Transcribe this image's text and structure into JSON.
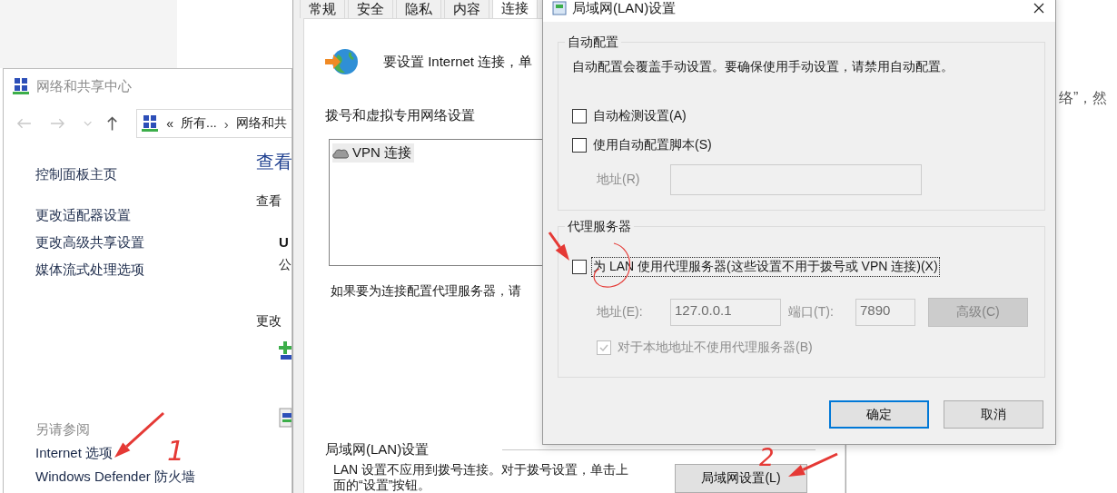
{
  "background_page": {
    "text": "络”，然"
  },
  "network_center": {
    "title": "网络和共享中心",
    "address": {
      "overflow": "«",
      "segments": [
        "所有...",
        "网络和共"
      ],
      "separator": "›"
    },
    "sidebar": {
      "items": [
        "控制面板主页",
        "更改适配器设置",
        "更改高级共享设置",
        "媒体流式处理选项"
      ],
      "see_also": {
        "title": "另请参阅",
        "items": [
          "Internet 选项",
          "Windows Defender 防火墙"
        ]
      }
    },
    "main": {
      "heading": "查看",
      "subheading": "查看",
      "network_name": "U",
      "network_type": "公",
      "change_heading": "更改"
    }
  },
  "internet_options": {
    "tabs": [
      {
        "label": "常规",
        "selected": false
      },
      {
        "label": "安全",
        "selected": false
      },
      {
        "label": "隐私",
        "selected": false
      },
      {
        "label": "内容",
        "selected": false
      },
      {
        "label": "连接",
        "selected": true
      }
    ],
    "intro": "要设置 Internet 连接，单",
    "dialup_heading": "拨号和虚拟专用网络设置",
    "connections": [
      {
        "label": "VPN 连接",
        "selected": true
      }
    ],
    "proxy_hint": "如果要为连接配置代理服务器，请",
    "lan": {
      "heading": "局域网(LAN)设置",
      "description": "LAN 设置不应用到拨号连接。对于拨号设置，单击上",
      "description_2": "面的“设置”按钮。",
      "button": "局域网设置(L)"
    }
  },
  "lan_dialog": {
    "title": "局域网(LAN)设置",
    "auto_config": {
      "legend": "自动配置",
      "description": "自动配置会覆盖手动设置。要确保使用手动设置，请禁用自动配置。",
      "options": [
        {
          "label": "自动检测设置(A)",
          "checked": false,
          "disabled": false
        },
        {
          "label": "使用自动配置脚本(S)",
          "checked": false,
          "disabled": false
        }
      ],
      "address": {
        "label": "地址(R)",
        "disabled": true
      }
    },
    "proxy": {
      "legend": "代理服务器",
      "use_proxy": {
        "label": "为 LAN 使用代理服务器(这些设置不用于拨号或 VPN 连接)(X)",
        "checked": false,
        "focused": true
      },
      "address": {
        "label": "地址(E):",
        "value": "127.0.0.1",
        "disabled": true
      },
      "port": {
        "label": "端口(T):",
        "value": "7890",
        "disabled": true
      },
      "advanced": {
        "label": "高级(C)",
        "disabled": true
      },
      "bypass_local": {
        "label": "对于本地地址不使用代理服务器(B)",
        "checked": true,
        "disabled": true
      }
    },
    "buttons": [
      {
        "label": "确定",
        "default": true
      },
      {
        "label": "取消",
        "default": false
      }
    ]
  },
  "annotations": [
    {
      "kind": "arrow"
    },
    {
      "kind": "number",
      "text": "1"
    },
    {
      "kind": "arrow"
    },
    {
      "kind": "circle"
    },
    {
      "kind": "number",
      "text": "2"
    },
    {
      "kind": "arrow"
    }
  ]
}
